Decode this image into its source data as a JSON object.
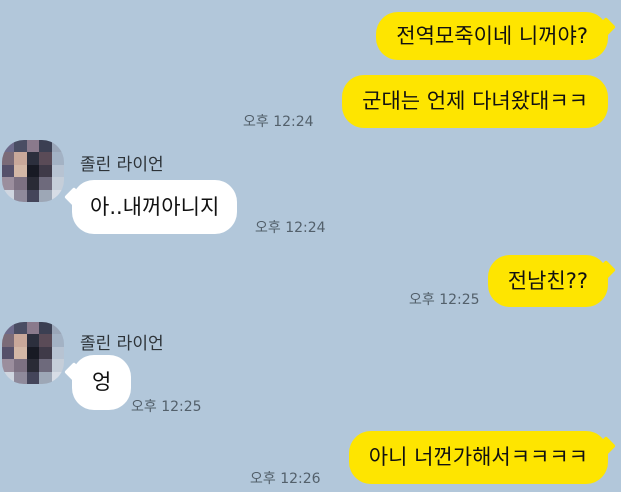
{
  "contact": {
    "name": "졸린 라이언"
  },
  "messages": [
    {
      "side": "mine",
      "text": "전역모죽이네 니꺼야?"
    },
    {
      "side": "mine",
      "text": "군대는 언제 다녀왔대ㅋㅋ",
      "time": "오후 12:24"
    },
    {
      "side": "theirs",
      "text": "아..내꺼아니지",
      "time": "오후 12:24"
    },
    {
      "side": "mine",
      "text": "전남친??",
      "time": "오후 12:25"
    },
    {
      "side": "theirs",
      "text": "엉",
      "time": "오후 12:25"
    },
    {
      "side": "mine",
      "text": "아니 너껀가해서ㅋㅋㅋㅋ",
      "time": "오후 12:26"
    }
  ],
  "colors": {
    "background": "#b2c7da",
    "my_bubble": "#fee500",
    "their_bubble": "#ffffff"
  },
  "avatar_icon": "pixelated-profile-photo-icon"
}
